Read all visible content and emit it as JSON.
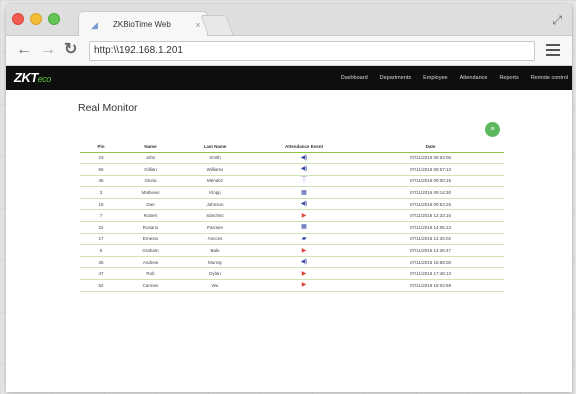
{
  "browser": {
    "tab_title": "ZKBioTime Web",
    "tab_close": "×",
    "url": "http:\\\\192.168.1.201"
  },
  "app": {
    "logo_main": "ZKT",
    "logo_sub": "eco",
    "nav": [
      "Dashboard",
      "Departments",
      "Employee",
      "Attendance",
      "Reports",
      "Remote control"
    ]
  },
  "page": {
    "title": "Real Monitor",
    "columns": [
      "Pin",
      "Name",
      "Last Name",
      "Attendance Event",
      "Date"
    ],
    "rows": [
      {
        "pin": "23",
        "name": "John",
        "last": "Smith",
        "event": "fingerprint-icon",
        "date": "07/11/2016 08:53:06"
      },
      {
        "pin": "56",
        "name": "Gillian",
        "last": "Williams",
        "event": "fingerprint-icon",
        "date": "07/11/2016 08:57:13"
      },
      {
        "pin": "45",
        "name": "Gloria",
        "last": "Méndez",
        "event": "palm-icon",
        "date": "07/11/2016 09:00:15"
      },
      {
        "pin": "3",
        "name": "Mathews",
        "last": "Klopp",
        "event": "card-icon",
        "date": "07/11/2016 09:14:30"
      },
      {
        "pin": "16",
        "name": "Dan",
        "last": "Johnson",
        "event": "fingerprint-icon",
        "date": "07/11/2016 09:53:26"
      },
      {
        "pin": "7",
        "name": "Robert",
        "last": "Sánchez",
        "event": "face-icon",
        "date": "07/11/2016 12:33:16"
      },
      {
        "pin": "22",
        "name": "Rosario",
        "last": "Parraire",
        "event": "card-icon",
        "date": "07/11/2016 14:05:13"
      },
      {
        "pin": "17",
        "name": "Ernesto",
        "last": "Ancces",
        "event": "password-icon",
        "date": "07/11/2016 14:26:02"
      },
      {
        "pin": "5",
        "name": "Graham",
        "last": "Bale",
        "event": "face-icon",
        "date": "07/11/2016 14:36:47"
      },
      {
        "pin": "36",
        "name": "Andrew",
        "last": "Murray",
        "event": "fingerprint-icon",
        "date": "07/11/2016 16:58:00"
      },
      {
        "pin": "47",
        "name": "Rob",
        "last": "Dylan",
        "event": "face-icon",
        "date": "07/11/2016 17:46:13"
      },
      {
        "pin": "52",
        "name": "Carmen",
        "last": "Wu",
        "event": "face-icon",
        "date": "07/11/2016 18:02:58"
      }
    ]
  },
  "event_icons": {
    "fingerprint-icon": {
      "glyph": "◀)",
      "color": "#3a47a0"
    },
    "palm-icon": {
      "glyph": "⏉",
      "color": "#3a47a0"
    },
    "card-icon": {
      "glyph": "▦",
      "color": "#2f3c9e"
    },
    "face-icon": {
      "glyph": "▶",
      "color": "#e0413b"
    },
    "password-icon": {
      "glyph": "▰",
      "color": "#223399"
    }
  },
  "colors": {
    "accent_green": "#5cb85c",
    "row_line": "#8cc63f",
    "appbar": "#0e0e0e"
  }
}
